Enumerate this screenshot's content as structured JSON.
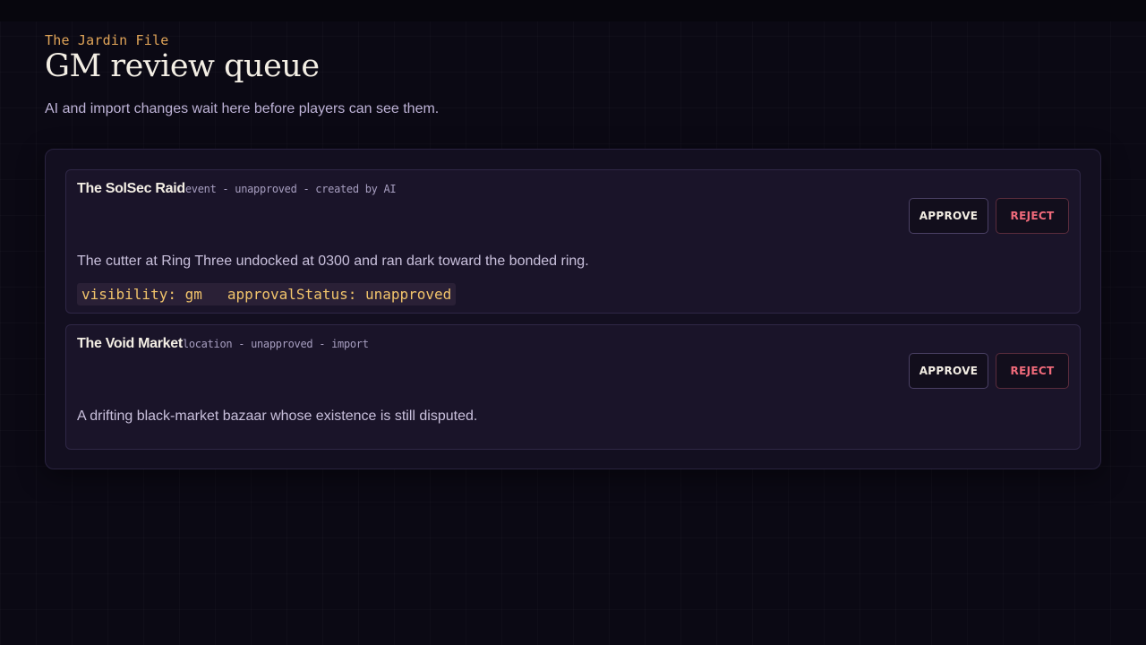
{
  "header": {
    "eyebrow": "The Jardin File",
    "title": "GM review queue",
    "subtitle": "AI and import changes wait here before players can see them."
  },
  "queue": {
    "items": [
      {
        "title": "The SolSec Raid",
        "meta": "event - unapproved - created by AI",
        "approve_label": "APPROVE",
        "reject_label": "REJECT",
        "description": "The cutter at Ring Three undocked at 0300 and ran dark toward the bonded ring.",
        "fields": [
          "visibility: gm",
          "approvalStatus: unapproved"
        ]
      },
      {
        "title": "The Void Market",
        "meta": "location - unapproved - import",
        "approve_label": "APPROVE",
        "reject_label": "REJECT",
        "description": "A drifting black-market bazaar whose existence is still disputed."
      }
    ]
  },
  "colors": {
    "background": "#0b0914",
    "panel": "#130f20",
    "card": "#1a1429",
    "accent": "#e0a458",
    "code_text": "#f2c46b",
    "reject": "#f06a7a"
  }
}
